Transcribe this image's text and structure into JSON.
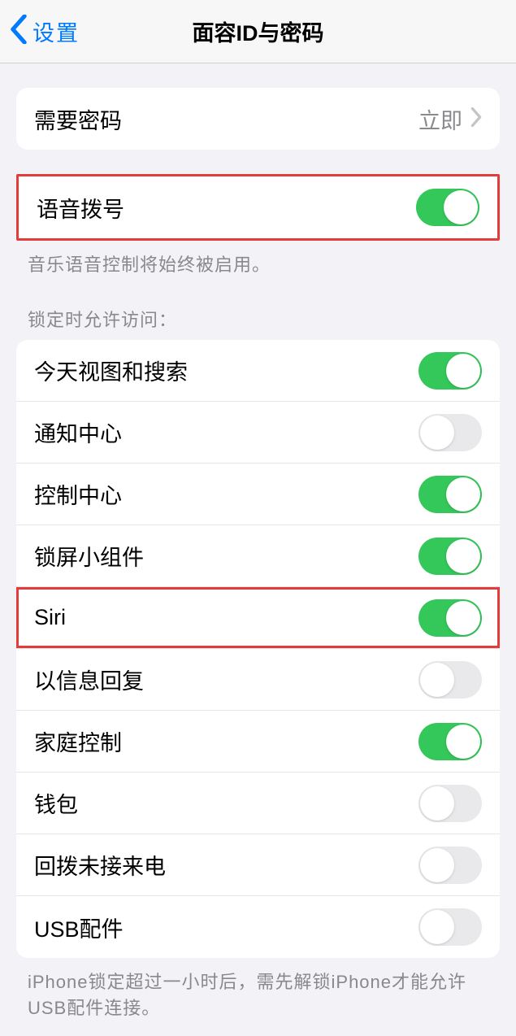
{
  "nav": {
    "back_label": "设置",
    "title": "面容ID与密码"
  },
  "passcode": {
    "label": "需要密码",
    "value": "立即"
  },
  "voice_dial": {
    "label": "语音拨号",
    "on": true,
    "footer": "音乐语音控制将始终被启用。"
  },
  "lock_section": {
    "header": "锁定时允许访问：",
    "items": [
      {
        "label": "今天视图和搜索",
        "on": true
      },
      {
        "label": "通知中心",
        "on": false
      },
      {
        "label": "控制中心",
        "on": true
      },
      {
        "label": "锁屏小组件",
        "on": true
      },
      {
        "label": "Siri",
        "on": true,
        "highlighted": true
      },
      {
        "label": "以信息回复",
        "on": false
      },
      {
        "label": "家庭控制",
        "on": true
      },
      {
        "label": "钱包",
        "on": false
      },
      {
        "label": "回拨未接来电",
        "on": false
      },
      {
        "label": "USB配件",
        "on": false
      }
    ],
    "footer": "iPhone锁定超过一小时后，需先解锁iPhone才能允许USB配件连接。"
  }
}
